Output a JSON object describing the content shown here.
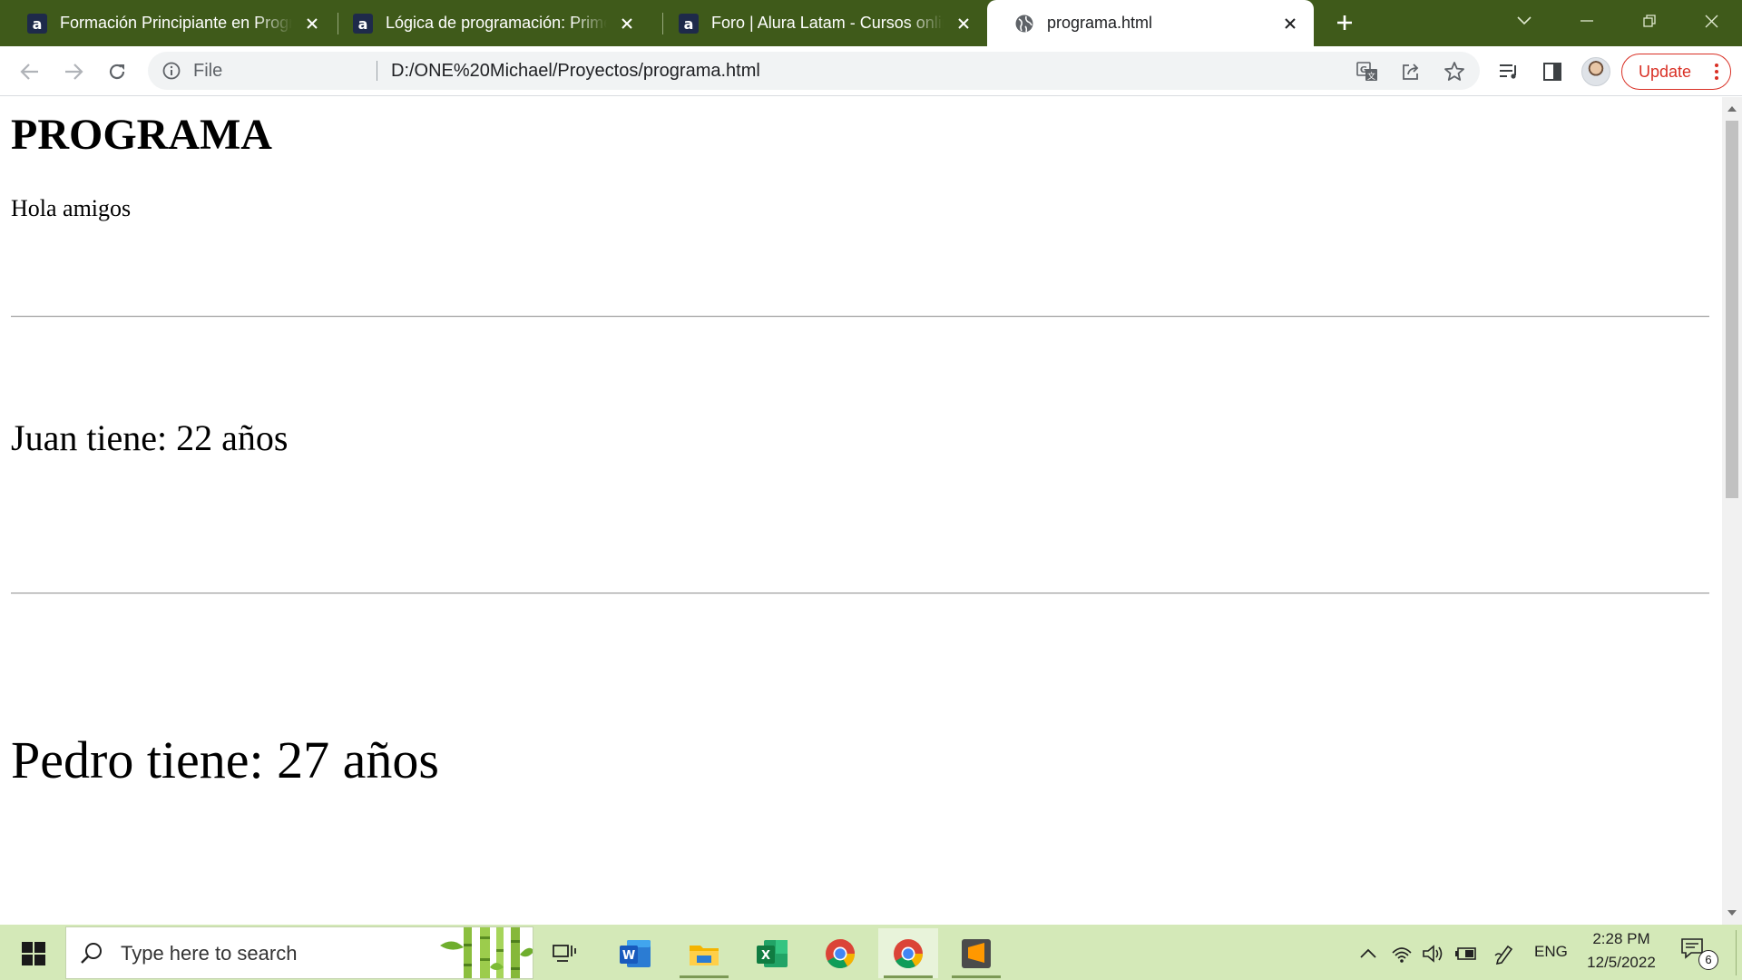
{
  "browser": {
    "tabs": [
      {
        "title": "Formación Principiante en Progra",
        "favicon": "alura-favicon",
        "active": false
      },
      {
        "title": "Lógica de programación: Primero",
        "favicon": "alura-favicon",
        "active": false
      },
      {
        "title": "Foro | Alura Latam - Cursos online",
        "favicon": "alura-favicon",
        "active": false
      },
      {
        "title": "programa.html",
        "favicon": "globe-icon",
        "active": true
      }
    ],
    "address_bar": {
      "scheme_label": "File",
      "url": "D:/ONE%20Michael/Proyectos/programa.html"
    },
    "update_button": {
      "label": "Update"
    },
    "accent_color": "#3f5a1a",
    "update_color": "#d93025"
  },
  "page": {
    "heading": "PROGRAMA",
    "greeting": "Hola amigos",
    "lines": [
      "Juan tiene: 22 años",
      "Pedro tiene: 27 años"
    ]
  },
  "taskbar": {
    "search_placeholder": "Type here to search",
    "apps": [
      "task-view",
      "word",
      "file-explorer",
      "excel",
      "chrome",
      "chrome",
      "sublime-text"
    ],
    "language": "ENG",
    "time": "2:28 PM",
    "date": "12/5/2022",
    "notification_count": "6",
    "color": "#d4e9b8"
  }
}
